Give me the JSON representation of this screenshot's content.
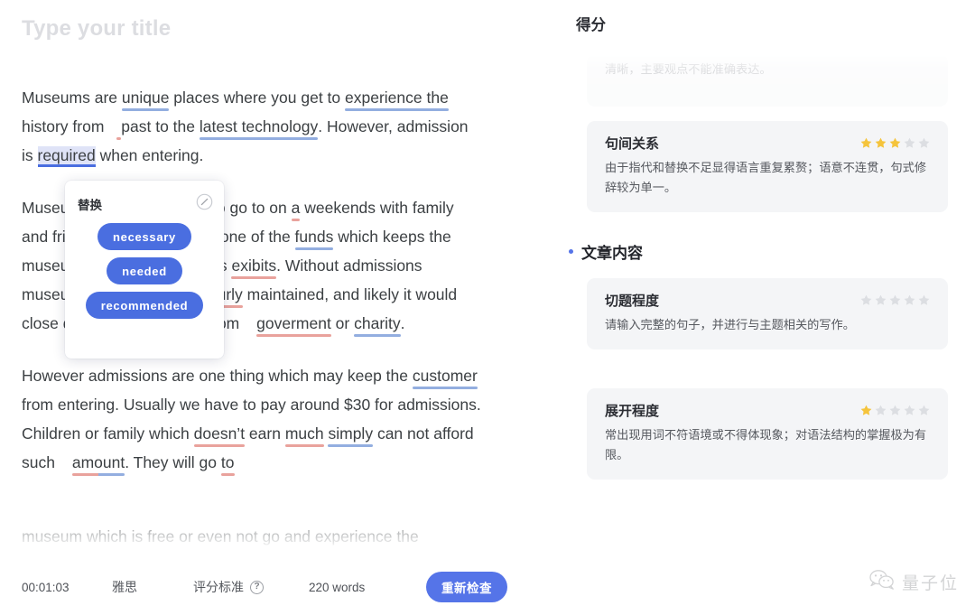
{
  "editor": {
    "title_placeholder": "Type your title",
    "paragraphs": [
      "Museums are unique places where you get to experience the history from past to the latest technology. However, admission is required when entering.",
      "Museums are great places to go to on a weekends with family and friends. Admissions are one of the funds which keeps the museum going to maintain its exibits. Without admissions museums would be dirty, pourly maintained, and likely it would close down unless funded from goverment or charity.",
      "However admissions are one thing which may keep the customer from entering. Usually we have to pay around $30 for admissions. Children or family which doesn't earn much simply can not afford such amount. They will go to"
    ],
    "fading_line": "museum which is free or even not go and experience the"
  },
  "popup": {
    "title": "替换",
    "ignore_icon": "ignore-icon",
    "suggestions": [
      "necessary",
      "needed",
      "recommended"
    ]
  },
  "toolbar": {
    "timer": "00:01:03",
    "exam_type": "雅思",
    "rubric_label": "评分标准",
    "help_icon": "?",
    "word_count": "220 words",
    "recheck_label": "重新检查"
  },
  "score_panel": {
    "heading": "得分",
    "clipped_card": {
      "description": "清晰，主要观点不能准确表达。"
    },
    "cards_top": [
      {
        "title": "句间关系",
        "stars_filled": 3,
        "stars_total": 5,
        "description": "由于指代和替换不足显得语言重复累赘；语意不连贯，句式修辞较为单一。"
      }
    ],
    "section": {
      "label": "文章内容"
    },
    "cards_content": [
      {
        "title": "切题程度",
        "stars_filled": 0,
        "stars_total": 5,
        "description": "请输入完整的句子，并进行与主题相关的写作。"
      },
      {
        "title": "展开程度",
        "stars_filled": 1,
        "stars_total": 5,
        "description": "常出现用词不符语境或不得体现象；对语法结构的掌握极为有限。"
      }
    ]
  },
  "watermark": {
    "icon": "wechat-icon",
    "text": "量子位"
  },
  "colors": {
    "accent_blue": "#5574e8",
    "pill_blue": "#4a6ee0",
    "star_filled": "#f5c43c",
    "star_empty": "#dcdee2",
    "underline_blue": "#93aee0",
    "underline_red": "#e9a29c",
    "card_bg": "#f4f5f7"
  }
}
